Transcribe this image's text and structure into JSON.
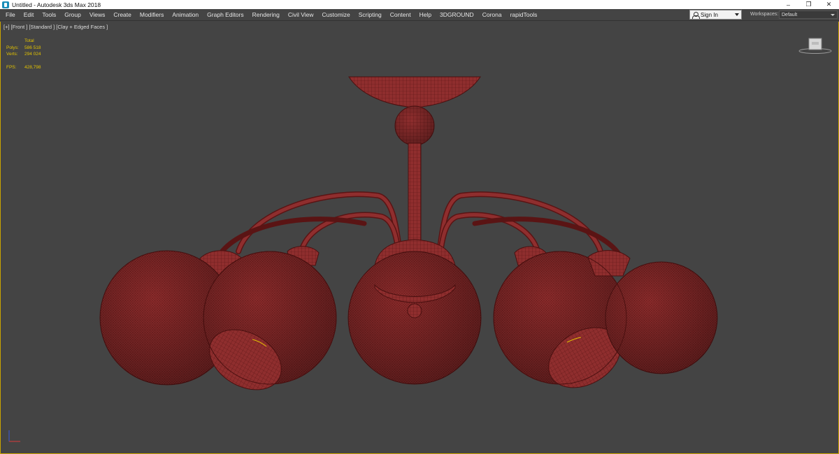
{
  "window": {
    "title": "Untitled - Autodesk 3ds Max 2018",
    "controls": [
      "–",
      "❐",
      "✕"
    ]
  },
  "menu": [
    "File",
    "Edit",
    "Tools",
    "Group",
    "Views",
    "Create",
    "Modifiers",
    "Animation",
    "Graph Editors",
    "Rendering",
    "Civil View",
    "Customize",
    "Scripting",
    "Content",
    "Help",
    "3DGROUND",
    "Corona",
    "rapidTools"
  ],
  "signin": {
    "label": "Sign In",
    "icon": "user-icon"
  },
  "workspaces": {
    "label": "Workspaces:",
    "value": "Default"
  },
  "viewport": {
    "label": "[+] [Front ] [Standard ] [Clay + Edged Faces ]",
    "stats": {
      "header": "Total",
      "polys_label": "Polys:",
      "polys": "586 518",
      "verts_label": "Verts:",
      "verts": "294 024",
      "fps_label": "FPS:",
      "fps": "428,798"
    },
    "model_color": "#8f2e2e",
    "wire_color": "#5a1414",
    "border_color": "#c9a400"
  }
}
